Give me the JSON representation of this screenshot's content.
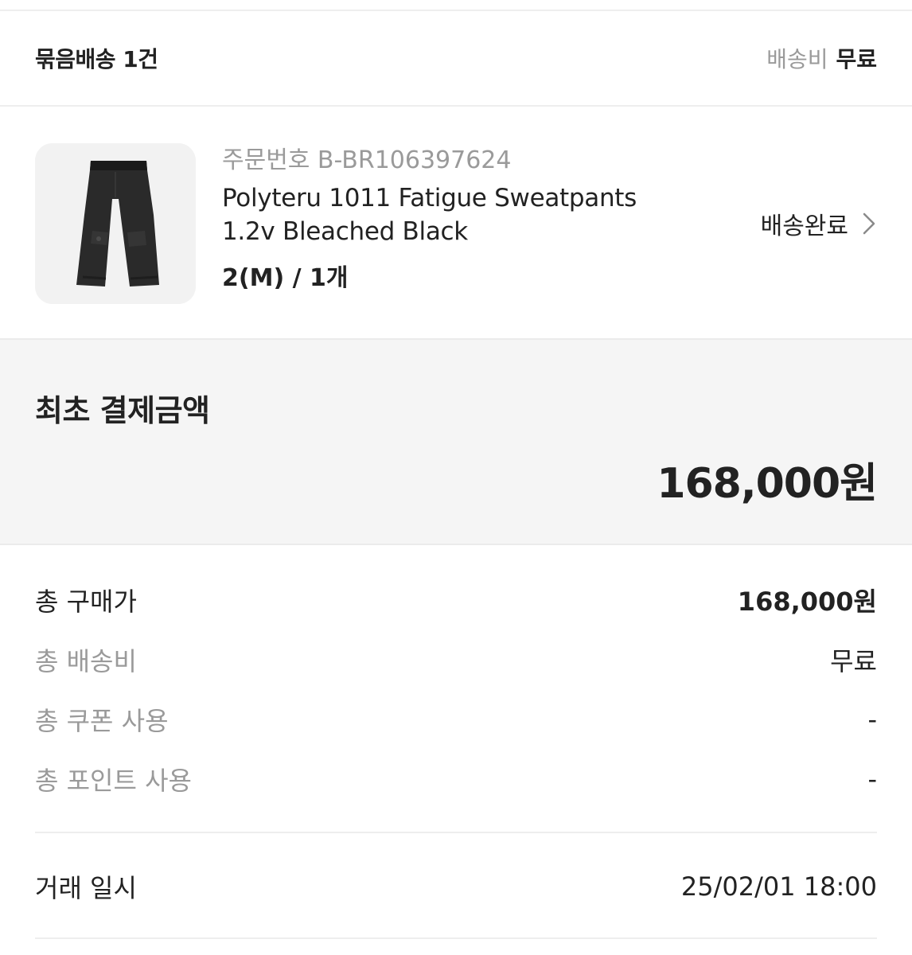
{
  "bundle": {
    "title": "묶음배송 1건",
    "shipping_label": "배송비",
    "shipping_value": "무료"
  },
  "product": {
    "image_icon": "sweatpants-photo",
    "order_number": "주문번호 B-BR106397624",
    "name_line1": "Polyteru 1011 Fatigue Sweatpants",
    "name_line2": "1.2v Bleached Black",
    "option": "2(M) / 1개",
    "status": "배송완료",
    "status_icon": "chevron-right-icon"
  },
  "payment": {
    "title": "최초 결제금액",
    "amount": "168,000원"
  },
  "summary": {
    "rows": [
      {
        "label": "총 구매가",
        "value": "168,000원"
      },
      {
        "label": "총 배송비",
        "value": "무료"
      },
      {
        "label": "총 쿠폰 사용",
        "value": "-"
      },
      {
        "label": "총 포인트 사용",
        "value": "-"
      }
    ]
  },
  "transaction": {
    "label": "거래 일시",
    "value": "25/02/01 18:00"
  },
  "colors": {
    "text_primary": "#222222",
    "text_secondary": "#9a9a9a",
    "panel_bg": "#f5f5f5",
    "divider": "#eeeeee"
  }
}
